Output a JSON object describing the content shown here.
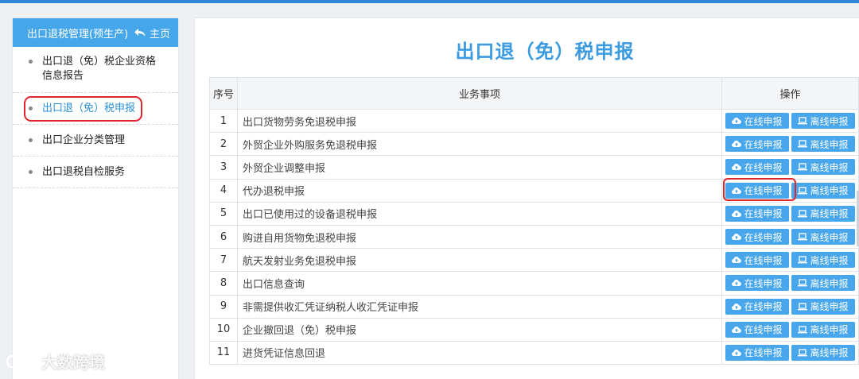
{
  "sidebar": {
    "title": "出口退税管理(预生产)",
    "home_label": "主页",
    "items": [
      {
        "label": "出口退（免）税企业资格信息报告"
      },
      {
        "label": "出口退（免）税申报"
      },
      {
        "label": "出口企业分类管理"
      },
      {
        "label": "出口退税自检服务"
      }
    ]
  },
  "main": {
    "title": "出口退（免）税申报",
    "table": {
      "headers": {
        "index": "序号",
        "item": "业务事项",
        "ops": "操作"
      },
      "online_label": "在线申报",
      "offline_label": "离线申报",
      "rows": [
        {
          "index": "1",
          "name": "出口货物劳务免退税申报"
        },
        {
          "index": "2",
          "name": "外贸企业外购服务免退税申报"
        },
        {
          "index": "3",
          "name": "外贸企业调整申报"
        },
        {
          "index": "4",
          "name": "代办退税申报"
        },
        {
          "index": "5",
          "name": "出口已使用过的设备退税申报"
        },
        {
          "index": "6",
          "name": "购进自用货物免退税申报"
        },
        {
          "index": "7",
          "name": "航天发射业务免退税申报"
        },
        {
          "index": "8",
          "name": "出口信息查询"
        },
        {
          "index": "9",
          "name": "非需提供收汇凭证纳税人收汇凭证申报"
        },
        {
          "index": "10",
          "name": "企业撤回退（免）税申报"
        },
        {
          "index": "11",
          "name": "进货凭证信息回退"
        }
      ]
    }
  },
  "watermark": {
    "text": "大数跨境"
  },
  "colors": {
    "accent": "#45a7ea",
    "button": "#47a6ec",
    "title": "#3c9be0",
    "highlight": "#e0262d"
  },
  "icons": {
    "home": "reply-arrow-icon",
    "online": "cloud-upload-icon",
    "offline": "laptop-icon"
  }
}
